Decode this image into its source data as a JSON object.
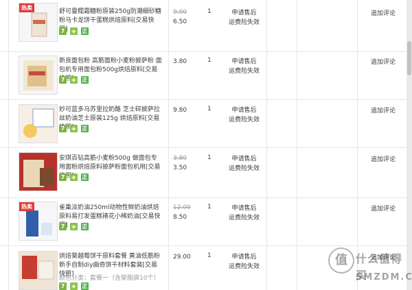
{
  "items": [
    {
      "title": "舒可曼糯霜糖粉原装250g防潮细砂糖粉马卡龙饼干蛋糕烘焙原料[交易快照]",
      "badge": "热卖",
      "price_old": "9.00",
      "price_current": "6.50",
      "qty": "1",
      "service_1": "申请售后",
      "service_2": "运费险失效",
      "review": "追加评论"
    },
    {
      "title": "新良面包粉 高筋面粉小麦粉披萨粉 面包机专用面包粉500g烘焙原料[交易快照]",
      "badge": "",
      "price_old": "",
      "price_current": "3.80",
      "qty": "1",
      "service_1": "申请售后",
      "service_2": "运费险失效",
      "review": "追加评论"
    },
    {
      "title": "妙可蓝多马苏里拉奶酪 芝士碎披萨拉丝奶油芝士原装125g 烘焙原料[交易快照]",
      "badge": "",
      "price_old": "",
      "price_current": "9.80",
      "qty": "1",
      "service_1": "申请售后",
      "service_2": "运费险失效",
      "review": "追加评论"
    },
    {
      "title": "安琪百钻高筋小麦粉500g 做面包专用面粉烘焙原料披萨粉面包机用[交易快照]",
      "badge": "",
      "price_old": "3.80",
      "price_current": "3.50",
      "qty": "1",
      "service_1": "申请售后",
      "service_2": "运费险失效",
      "review": "追加评论"
    },
    {
      "title": "雀巢淡奶油250ml动物性鲜奶油烘焙原料易打发蛋糕裱花小稀奶油[交易快照]",
      "badge": "热卖",
      "price_old": "12.00",
      "price_current": "8.50",
      "qty": "1",
      "service_1": "申请售后",
      "service_2": "运费险失效",
      "review": "追加评论"
    },
    {
      "title": "烘焙葵越莓饼干原料套餐 黄油低筋粉新手自制diy曲奇饼干材料套装[交易快照]",
      "badge": "",
      "price_old": "",
      "price_current": "29.00",
      "qty": "1",
      "service_1": "申请售后",
      "service_2": "运费险失效",
      "review": "追加评论",
      "variant": "颜色分类：套餐一（含架脂袋10个）"
    }
  ],
  "badges": {
    "seven": "7",
    "icon": "◈",
    "zheng": "正"
  },
  "watermark": {
    "logo": "值",
    "text": "什么值得买",
    "sub": "SMZDM.COM"
  }
}
